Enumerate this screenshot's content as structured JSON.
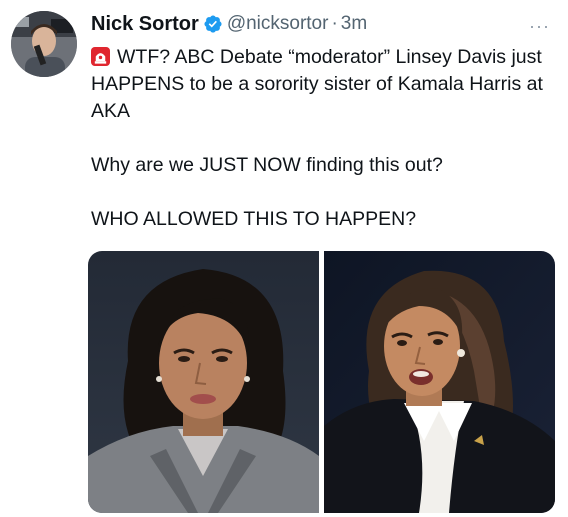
{
  "author": {
    "name": "Nick Sortor",
    "handle": "@nicksortor",
    "separator": "·",
    "time": "3m",
    "avatar_icon": "profile-photo-avatar",
    "verified_icon": "verified-badge-icon"
  },
  "menu": {
    "icon": "more-options-icon",
    "label": "···"
  },
  "tweet": {
    "line1": "WTF? ABC Debate “moderator” Linsey Davis just HAPPENS to be a sorority sister of Kamala Harris at AKA",
    "line2": "Why are we JUST NOW finding this out?",
    "line3": "WHO ALLOWED THIS TO HAPPEN?",
    "emoji_icon": "rotating-light-icon"
  },
  "media": {
    "left_image": "photo-woman-gray-blazer",
    "right_image": "photo-woman-black-suit-speaking"
  },
  "colors": {
    "text": "#0f1419",
    "secondary": "#536471",
    "verified": "#1d9bf0"
  }
}
